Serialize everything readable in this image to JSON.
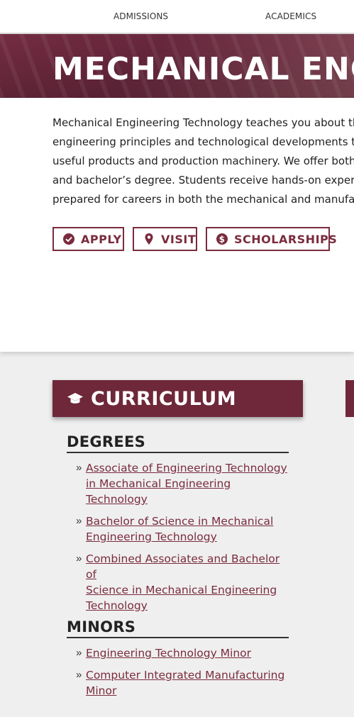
{
  "nav": {
    "admissions": "ADMISSIONS",
    "academics": "ACADEMICS"
  },
  "hero": {
    "title": "MECHANICAL ENGINEERING TECHNOLOGY"
  },
  "intro": {
    "lines": [
      "Mechanical Engineering Technology teaches you about th",
      "engineering principles and technological developments t",
      "useful products and production machinery. We offer both",
      "and bachelor’s degree. Students receive hands-on experie",
      "prepared for careers in both the mechanical and manufac"
    ]
  },
  "buttons": {
    "apply": {
      "label": "APPLY",
      "icon": "check-circle-icon"
    },
    "visit": {
      "label": "VISIT",
      "icon": "map-pin-icon"
    },
    "scholarships": {
      "label": "SCHOLARSHIPS",
      "icon": "dollar-circle-icon"
    }
  },
  "curriculum": {
    "title": "CURRICULUM",
    "icon": "graduation-cap-icon",
    "degrees": {
      "heading": "DEGREES",
      "items": [
        [
          "Associate of Engineering Technology",
          "in Mechanical Engineering",
          "Technology"
        ],
        [
          "Bachelor of Science in Mechanical",
          "Engineering Technology"
        ],
        [
          "Combined Associates and Bachelor of",
          "Science in Mechanical Engineering",
          "Technology"
        ]
      ]
    },
    "minors": {
      "heading": "MINORS",
      "items": [
        [
          "Engineering Technology Minor"
        ],
        [
          "Computer Integrated Manufacturing",
          "Minor"
        ]
      ]
    }
  },
  "bullet": "»",
  "colors": {
    "maroon": "#6e2839",
    "link": "#7a2b3e"
  }
}
